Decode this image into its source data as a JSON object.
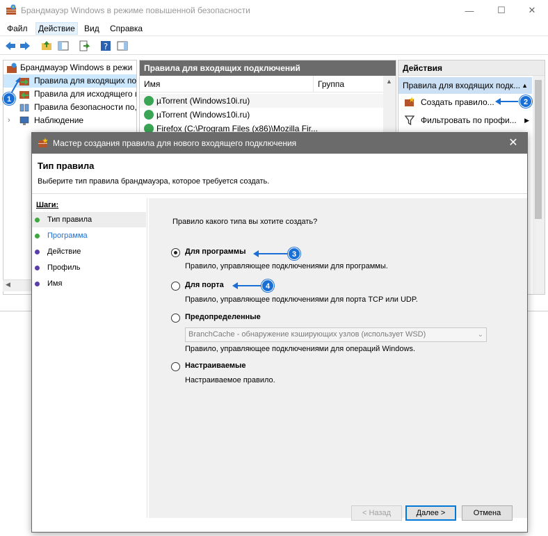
{
  "window": {
    "title": "Брандмауэр Windows в режиме повышенной безопасности",
    "minimize": "—",
    "maximize": "☐",
    "close": "✕"
  },
  "menu": [
    "Файл",
    "Действие",
    "Вид",
    "Справка"
  ],
  "tree": {
    "root": "Брандмауэр Windows в режи",
    "items": [
      "Правила для входящих по,",
      "Правила для исходящего п",
      "Правила безопасности по,",
      "Наблюдение"
    ]
  },
  "center": {
    "header": "Правила для входящих подключений",
    "columns": [
      "Имя",
      "Группа"
    ],
    "rows": [
      "µTorrent (Windows10i.ru)",
      "µTorrent (Windows10i.ru)",
      "Firefox (C:\\Program Files (x86)\\Mozilla Fir..."
    ]
  },
  "actions": {
    "header": "Действия",
    "subheader": "Правила для входящих подк...",
    "items": [
      "Создать правило...",
      "Фильтровать по профи..."
    ]
  },
  "badges": [
    "1",
    "2",
    "3",
    "4"
  ],
  "dialog": {
    "title": "Мастер создания правила для нового входящего подключения",
    "close": "✕",
    "heading": "Тип правила",
    "subheading": "Выберите тип правила брандмауэра, которое требуется создать.",
    "steps_label": "Шаги:",
    "steps": [
      "Тип правила",
      "Программа",
      "Действие",
      "Профиль",
      "Имя"
    ],
    "question": "Правило какого типа вы хотите создать?",
    "options": [
      {
        "label": "Для программы",
        "desc": "Правило, управляющее подключениями для программы.",
        "selected": true
      },
      {
        "label": "Для порта",
        "desc": "Правило, управляющее подключениями для порта TCP или UDP.",
        "selected": false
      },
      {
        "label": "Предопределенные",
        "desc": "Правило, управляющее подключениями для операций Windows.",
        "selected": false
      },
      {
        "label": "Настраиваемые",
        "desc": "Настраиваемое правило.",
        "selected": false
      }
    ],
    "combo_value": "BranchCache - обнаружение кэширующих узлов (использует WSD)",
    "buttons": {
      "back": "< Назад",
      "next": "Далее >",
      "cancel": "Отмена"
    }
  },
  "colors": {
    "accent": "#1a6fd6",
    "dialog_title": "#6b6b6b",
    "step_done": "#3da83d",
    "step_todo": "#5b3fa8"
  }
}
